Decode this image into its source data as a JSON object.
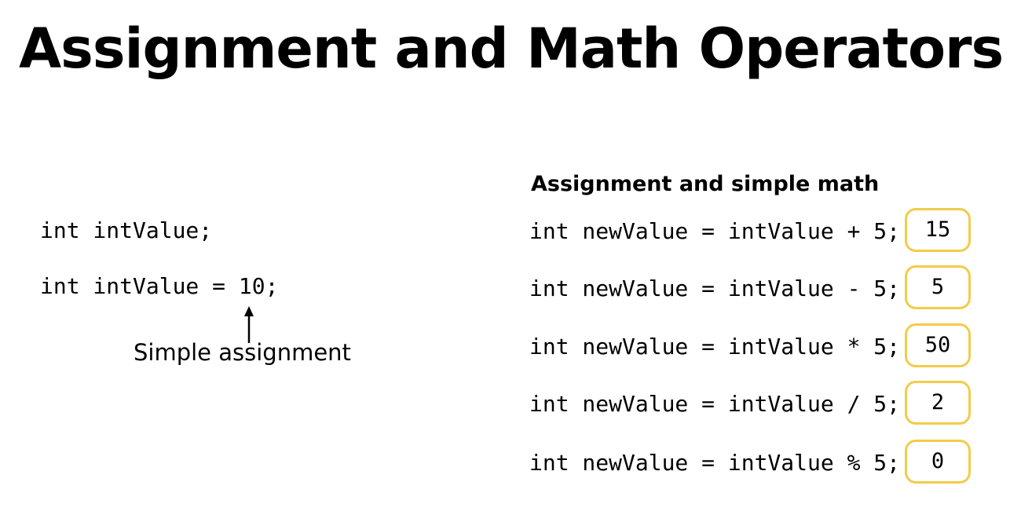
{
  "title": "Assignment and Math Operators",
  "left": {
    "declaration": "int intValue;",
    "assignment": "int intValue = 10;",
    "caption": "Simple assignment"
  },
  "right": {
    "heading": "Assignment and simple math",
    "rows": [
      {
        "code": "int newValue = intValue + 5;",
        "result": "15"
      },
      {
        "code": "int newValue = intValue - 5;",
        "result": "5"
      },
      {
        "code": "int newValue = intValue * 5;",
        "result": "50"
      },
      {
        "code": "int newValue = intValue / 5;",
        "result": "2"
      },
      {
        "code": "int newValue = intValue % 5;",
        "result": "0"
      }
    ]
  },
  "colors": {
    "result_border": "#f2cc4a",
    "text": "#000000",
    "background": "#ffffff"
  }
}
